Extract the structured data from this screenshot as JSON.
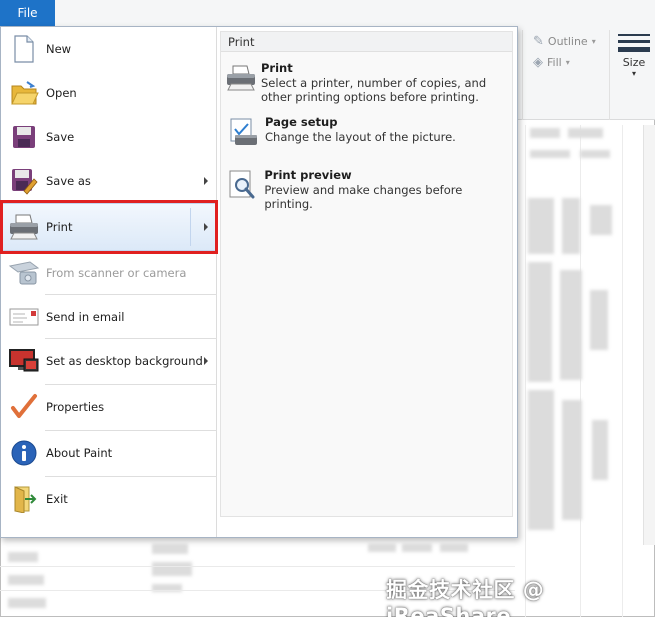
{
  "file_tab": {
    "label": "File"
  },
  "menu": {
    "items": [
      {
        "id": "new",
        "label": "New",
        "icon": "new-file-icon",
        "has_submenu": false,
        "disabled": false
      },
      {
        "id": "open",
        "label": "Open",
        "icon": "open-folder-icon",
        "has_submenu": false,
        "disabled": false
      },
      {
        "id": "save",
        "label": "Save",
        "icon": "save-disk-icon",
        "has_submenu": false,
        "disabled": false
      },
      {
        "id": "save-as",
        "label": "Save as",
        "icon": "save-as-icon",
        "has_submenu": true,
        "disabled": false
      },
      {
        "id": "print",
        "label": "Print",
        "icon": "printer-icon",
        "has_submenu": true,
        "disabled": false,
        "active": true
      },
      {
        "id": "scanner",
        "label": "From scanner or camera",
        "icon": "scanner-icon",
        "has_submenu": false,
        "disabled": true
      },
      {
        "id": "email",
        "label": "Send in email",
        "icon": "email-icon",
        "has_submenu": false,
        "disabled": false
      },
      {
        "id": "desktop-bg",
        "label": "Set as desktop background",
        "icon": "desktop-background-icon",
        "has_submenu": true,
        "disabled": false
      },
      {
        "id": "properties",
        "label": "Properties",
        "icon": "checkmark-icon",
        "has_submenu": false,
        "disabled": false
      },
      {
        "id": "about",
        "label": "About Paint",
        "icon": "info-icon",
        "has_submenu": false,
        "disabled": false
      },
      {
        "id": "exit",
        "label": "Exit",
        "icon": "exit-icon",
        "has_submenu": false,
        "disabled": false
      }
    ]
  },
  "print_pane": {
    "title": "Print",
    "items": [
      {
        "title": "Print",
        "description": "Select a printer, number of copies, and other printing options before printing.",
        "icon": "printer-icon"
      },
      {
        "title": "Page setup",
        "description": "Change the layout of the picture.",
        "icon": "page-setup-icon"
      },
      {
        "title": "Print preview",
        "description": "Preview and make changes before printing.",
        "icon": "print-preview-icon"
      }
    ]
  },
  "ribbon": {
    "outline_label": "Outline",
    "fill_label": "Fill",
    "size_label": "Size"
  },
  "watermark": {
    "text": "掘金技术社区 @ iReaShare"
  },
  "colors": {
    "file_tab": "#1e73c8",
    "highlight_border": "#e02020",
    "active_item": "#dce9f8"
  }
}
